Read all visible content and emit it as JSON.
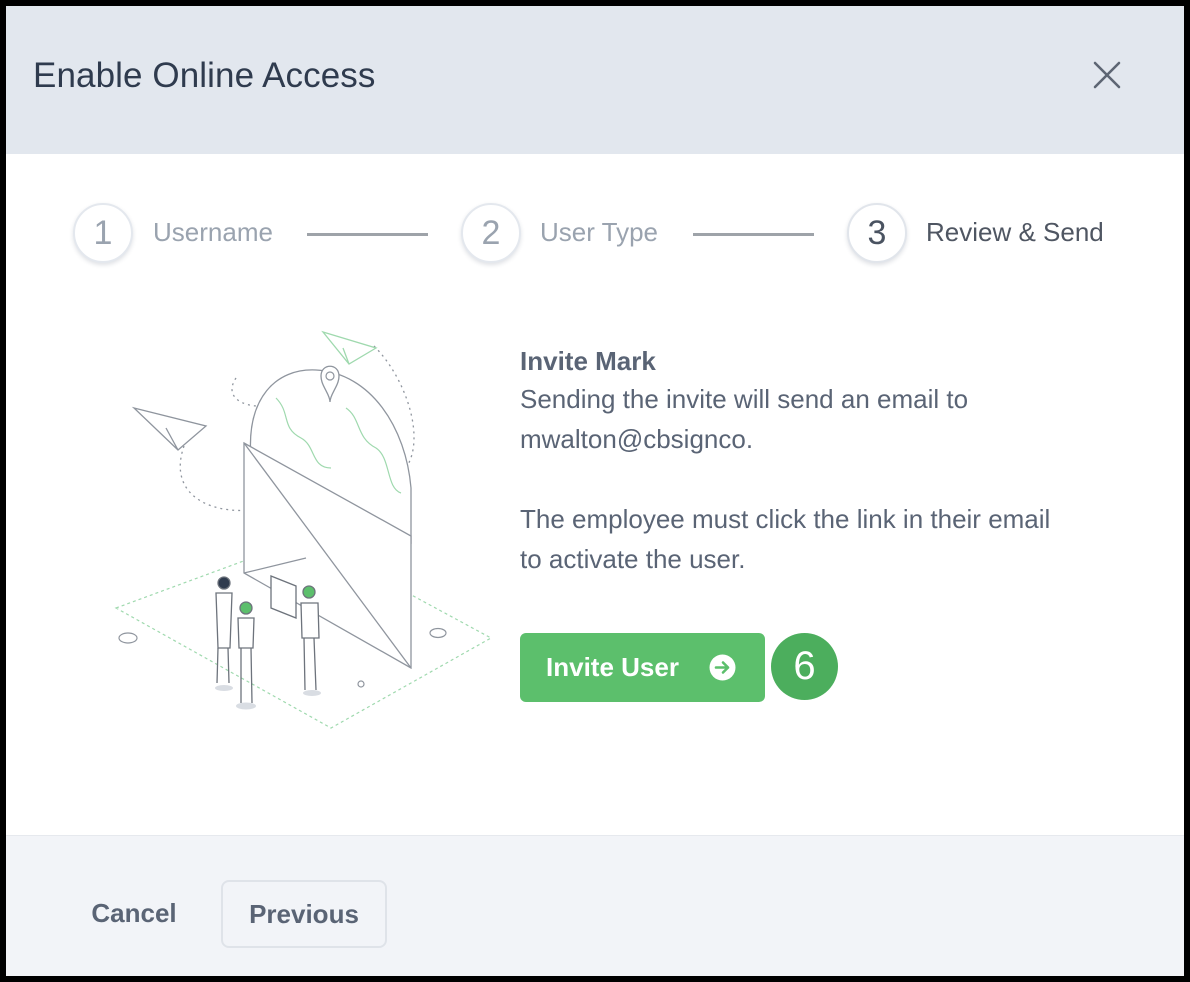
{
  "modal": {
    "title": "Enable Online Access"
  },
  "stepper": {
    "steps": [
      {
        "number": "1",
        "label": "Username",
        "state": "inactive"
      },
      {
        "number": "2",
        "label": "User Type",
        "state": "inactive"
      },
      {
        "number": "3",
        "label": "Review & Send",
        "state": "active"
      }
    ]
  },
  "content": {
    "heading": "Invite Mark",
    "line1": "Sending the invite will send an email to",
    "line2": "mwalton@cbsignco.",
    "line3": "The employee must click the link in their email",
    "line4": "to activate the user."
  },
  "actions": {
    "invite_label": "Invite User",
    "invite_icon": "arrow-right-circle-icon",
    "step_badge": "6"
  },
  "footer": {
    "cancel_label": "Cancel",
    "previous_label": "Previous"
  },
  "colors": {
    "header_bg": "#e2e7ee",
    "primary_green": "#5cbf6c",
    "badge_green": "#4cae5d",
    "text": "#5a6475",
    "title": "#2f3b4e",
    "footer_bg": "#f2f4f8"
  }
}
